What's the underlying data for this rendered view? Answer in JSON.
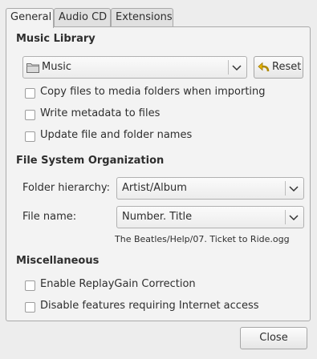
{
  "tabs": [
    {
      "label": "General"
    },
    {
      "label": "Audio CD"
    },
    {
      "label": "Extensions"
    }
  ],
  "music_library": {
    "title": "Music Library",
    "folder_value": "Music",
    "reset_label": "Reset",
    "options": [
      {
        "label": "Copy files to media folders when importing",
        "checked": false
      },
      {
        "label": "Write metadata to files",
        "checked": false
      },
      {
        "label": "Update file and folder names",
        "checked": false
      }
    ]
  },
  "file_system": {
    "title": "File System Organization",
    "hierarchy_label": "Folder hierarchy:",
    "hierarchy_value": "Artist/Album",
    "filename_label": "File name:",
    "filename_value": "Number. Title",
    "example": "The Beatles/Help/07. Ticket to Ride.ogg"
  },
  "misc": {
    "title": "Miscellaneous",
    "options": [
      {
        "label": "Enable ReplayGain Correction",
        "checked": false
      },
      {
        "label": "Disable features requiring Internet access",
        "checked": false
      }
    ]
  },
  "close_label": "Close",
  "colors": {
    "window_bg": "#ededed",
    "panel_bg": "#f3f3f3",
    "border": "#a9a9a9"
  }
}
